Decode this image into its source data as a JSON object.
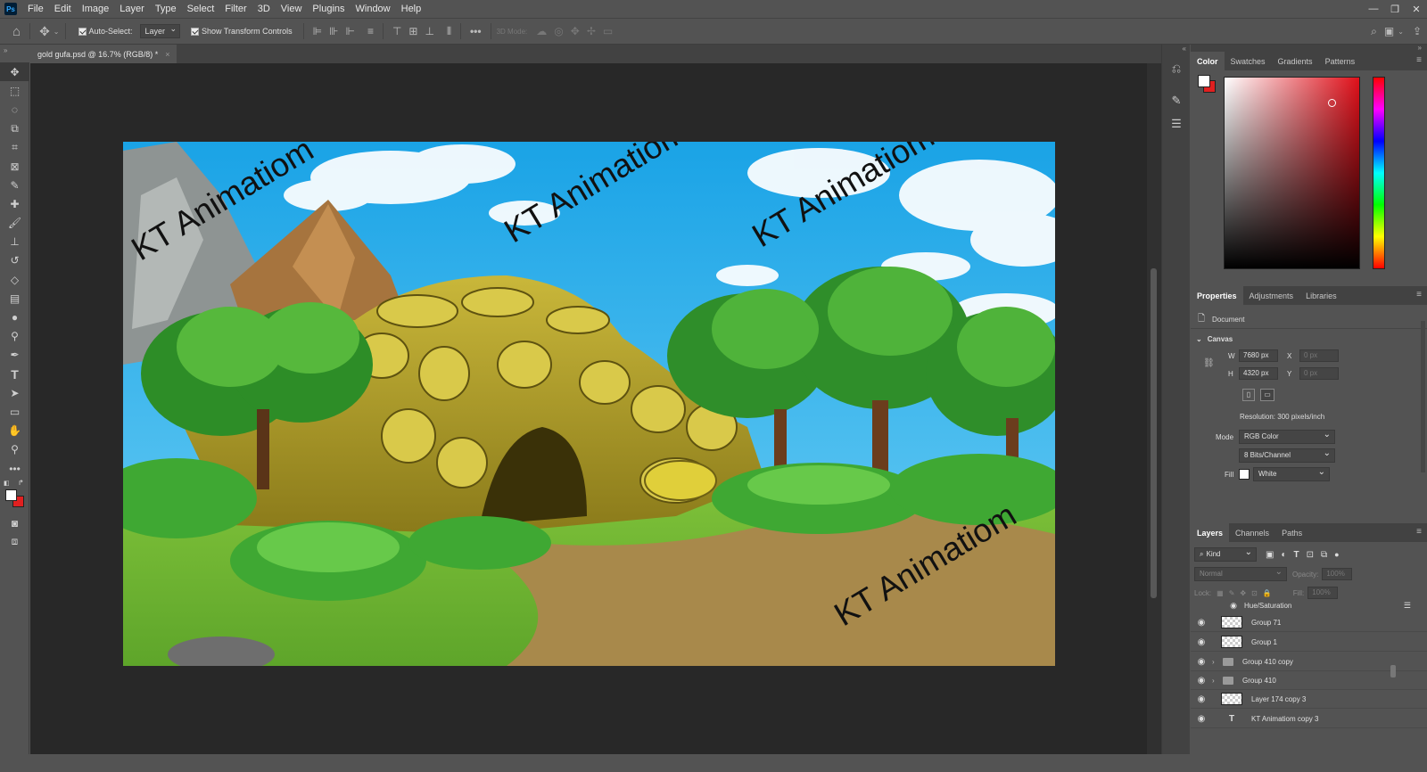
{
  "app": {
    "logo": "Ps"
  },
  "menu": [
    "File",
    "Edit",
    "Image",
    "Layer",
    "Type",
    "Select",
    "Filter",
    "3D",
    "View",
    "Plugins",
    "Window",
    "Help"
  ],
  "window_controls": [
    "—",
    "❐",
    "✕"
  ],
  "options_bar": {
    "auto_select_label": "Auto-Select:",
    "auto_select_target": "Layer",
    "transform_label": "Show Transform Controls",
    "more": "•••",
    "mode_3d_label": "3D Mode:"
  },
  "document_tab": {
    "title": "gold gufa.psd @ 16.7% (RGB/8) *",
    "close": "×"
  },
  "watermark_text": "KT Animatiom",
  "color_panel": {
    "tabs": [
      "Color",
      "Swatches",
      "Gradients",
      "Patterns"
    ],
    "foreground": "#ffffff",
    "background": "#e02020"
  },
  "properties_panel": {
    "tabs": [
      "Properties",
      "Adjustments",
      "Libraries"
    ],
    "doc_label": "Document",
    "section": "Canvas",
    "w_label": "W",
    "w_value": "7680 px",
    "h_label": "H",
    "h_value": "4320 px",
    "x_label": "X",
    "x_value": "0 px",
    "y_label": "Y",
    "y_value": "0 px",
    "resolution": "Resolution: 300 pixels/inch",
    "mode_label": "Mode",
    "mode_value": "RGB Color",
    "depth_value": "8 Bits/Channel",
    "fill_label": "Fill",
    "fill_value": "White"
  },
  "layers_panel": {
    "tabs": [
      "Layers",
      "Channels",
      "Paths"
    ],
    "kind_label": "Kind",
    "blend_mode": "Normal",
    "opacity_label": "Opacity:",
    "opacity_value": "100%",
    "lock_label": "Lock:",
    "fill_label": "Fill:",
    "fill_value": "100%",
    "adjustment_layer": "Hue/Saturation",
    "layers": [
      {
        "name": "Group 71",
        "kind": "raster"
      },
      {
        "name": "Group 1",
        "kind": "raster"
      },
      {
        "name": "Group 410 copy",
        "kind": "group"
      },
      {
        "name": "Group 410",
        "kind": "group"
      },
      {
        "name": "Layer 174 copy 3",
        "kind": "raster"
      },
      {
        "name": "KT Animatiom copy 3",
        "kind": "text"
      }
    ]
  }
}
